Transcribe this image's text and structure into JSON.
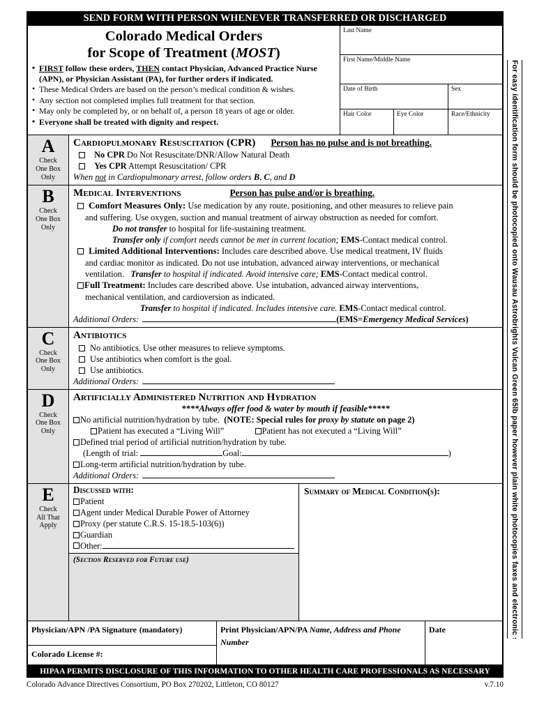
{
  "header_bar": "SEND FORM WITH PERSON WHENEVER TRANSFERRED OR DISCHARGED",
  "title": {
    "line1": "Colorado Medical Orders",
    "line2_pre": "for Scope of Treatment (",
    "line2_italic": "MOST",
    "line2_post": ")"
  },
  "bullets": [
    {
      "type": "bold",
      "segments": [
        {
          "t": "FIRST",
          "style": "bold-underline"
        },
        {
          "t": " follow these orders, ",
          "style": "bold"
        },
        {
          "t": "THEN",
          "style": "bold-underline"
        },
        {
          "t": " contact Physician, Advanced Practice Nurse (APN), or Physician Assistant (PA), for further orders if indicated.",
          "style": "bold"
        }
      ]
    },
    {
      "type": "normal",
      "text": "These Medical Orders are based on the person’s medical condition & wishes."
    },
    {
      "type": "normal",
      "text": "Any section not completed implies full treatment for that section."
    },
    {
      "type": "normal",
      "text": "May only be completed by, or on behalf of, a person 18 years of age or older."
    },
    {
      "type": "bold",
      "text": "Everyone shall be treated with dignity and respect."
    }
  ],
  "patient_fields": {
    "last_name": "Last Name",
    "first_middle_name": "First Name/Middle Name",
    "date_of_birth": "Date of Birth",
    "sex": "Sex",
    "hair_color": "Hair Color",
    "eye_color": "Eye Color",
    "race_ethnicity": "Race/Ethnicity"
  },
  "sections": {
    "A": {
      "letter": "A",
      "instruction": "Check One Box Only",
      "instruction_lines": [
        "Check",
        "One Box",
        "Only"
      ],
      "heading": "Cardiopulmonary Resuscitation (CPR)",
      "condition": "Person has no pulse and is not breathing.",
      "options": [
        {
          "bold": "No CPR",
          "rest": " Do Not Resuscitate/DNR/Allow Natural Death"
        },
        {
          "bold": "Yes CPR",
          "rest": " Attempt Resuscitation/ CPR"
        }
      ],
      "note_pre": "When ",
      "note_underline": "not",
      "note_post": " in Cardiopulmonary arrest, follow orders ",
      "note_b": "B",
      "note_sep1": ", ",
      "note_c": "C",
      "note_sep2": ", and ",
      "note_d": "D"
    },
    "B": {
      "letter": "B",
      "instruction_lines": [
        "Check",
        "One Box",
        "Only"
      ],
      "heading": "Medical Interventions",
      "condition": "Person has pulse and/or is breathing.",
      "opt1_title": "Comfort Measures Only:",
      "opt1_text": " Use medication by any route, positioning, and other measures to relieve pain",
      "opt1_text2": "and suffering. Use oxygen, suction and manual treatment of airway obstruction as needed for comfort.",
      "opt1_sub1_bi": "Do not transfer",
      "opt1_sub1_rest": " to hospital for life-sustaining treatment.",
      "opt1_sub2_bi": "Transfer only",
      "opt1_sub2_rest": " if comfort needs cannot be met in current location; ",
      "opt1_sub2_ems": "EMS",
      "opt1_sub2_tail": "-Contact medical control.",
      "opt2_title": "Limited Additional Interventions:",
      "opt2_text": " Includes care described above. Use medical treatment, IV fluids",
      "opt2_text2": "and cardiac monitor as indicated. Do not use intubation, advanced airway interventions, or mechanical",
      "opt2_text3_pre": "ventilation.",
      "opt2_text3_bi": "Transfer",
      "opt2_text3_it": " to hospital if indicated. Avoid intensive care;",
      "opt2_text3_ems": " EMS",
      "opt2_text3_tail": "-Contact medical control.",
      "opt3_title": "Full Treatment:",
      "opt3_text": " Includes care described above. Use intubation, advanced airway interventions,",
      "opt3_text2": "mechanical ventilation, and cardioversion as indicated.",
      "opt3_sub_bi": "Transfer",
      "opt3_sub_it": " to hospital if indicated. Includes intensive care.",
      "opt3_sub_ems": " EMS",
      "opt3_sub_tail": "-Contact medical control.",
      "additional_orders": "Additional Orders:",
      "ems_legend_pre": "(EMS=",
      "ems_legend_bi": "Emergency Medical Services",
      "ems_legend_post": ")"
    },
    "C": {
      "letter": "C",
      "instruction_lines": [
        "Check",
        "One Box",
        "Only"
      ],
      "heading": "Antibiotics",
      "options": [
        "No antibiotics. Use other measures to relieve symptoms.",
        "Use antibiotics when comfort is the goal.",
        "Use antibiotics."
      ],
      "additional_orders": "Additional Orders:"
    },
    "D": {
      "letter": "D",
      "instruction_lines": [
        "Check",
        "One Box",
        "Only"
      ],
      "heading": "Artificially Administered Nutrition and Hydration",
      "always_offer": "****Always offer food & water by mouth if feasible*****",
      "opt1_text": "No artificial nutrition/hydration by tube.",
      "opt1_note_pre": "(NOTE: Special rules for ",
      "opt1_note_it": "proxy by statute",
      "opt1_note_post": " on page 2)",
      "living_will_yes": "Patient has executed a “Living Will”",
      "living_will_no": "Patient has not executed a “Living Will”",
      "opt2_text": "Defined trial period of artificial nutrition/hydration by tube.",
      "trial_label": "(Length of trial:",
      "goal_label": "Goal:",
      "trial_close": ")",
      "opt3_text": "Long-term artificial nutrition/hydration by tube.",
      "additional_orders": "Additional Orders:"
    },
    "E": {
      "letter": "E",
      "instruction_lines": [
        "Check",
        "All That",
        "Apply"
      ],
      "discussed_with": "Discussed with:",
      "options": [
        "Patient",
        "Agent under Medical Durable Power of Attorney",
        "Proxy (per statute C.R.S. 15-18.5-103(6))",
        "Guardian"
      ],
      "other_label": "Other:",
      "future_use": "(Section Reserved for Future use)",
      "summary_title": "Summary of Medical Condition(s):"
    }
  },
  "signature": {
    "physician_signature": "Physician/APN /PA Signature",
    "physician_signature_note": "(mandatory)",
    "license": "Colorado License #:",
    "print_pre": "Print Physician/APN/PA ",
    "print_it": "Name,  Address and Phone Number",
    "date": "Date"
  },
  "hipaa_bar": "HIPAA PERMITS DISCLOSURE OF THIS INFORMATION  TO OTHER HEALTH CARE  PROFESSIONALS AS NECESSARY",
  "footer": {
    "left": "Colorado Advance Directives Consortium, PO Box 270202, Littleton, CO  80127",
    "right": "v.7.10"
  },
  "side_note": "For easy identification form should be photocopied onto  Wausau Astrobrights Vulcan Green  65lb paper  however  plain white photocopies  faxes and electronic scans are valid"
}
